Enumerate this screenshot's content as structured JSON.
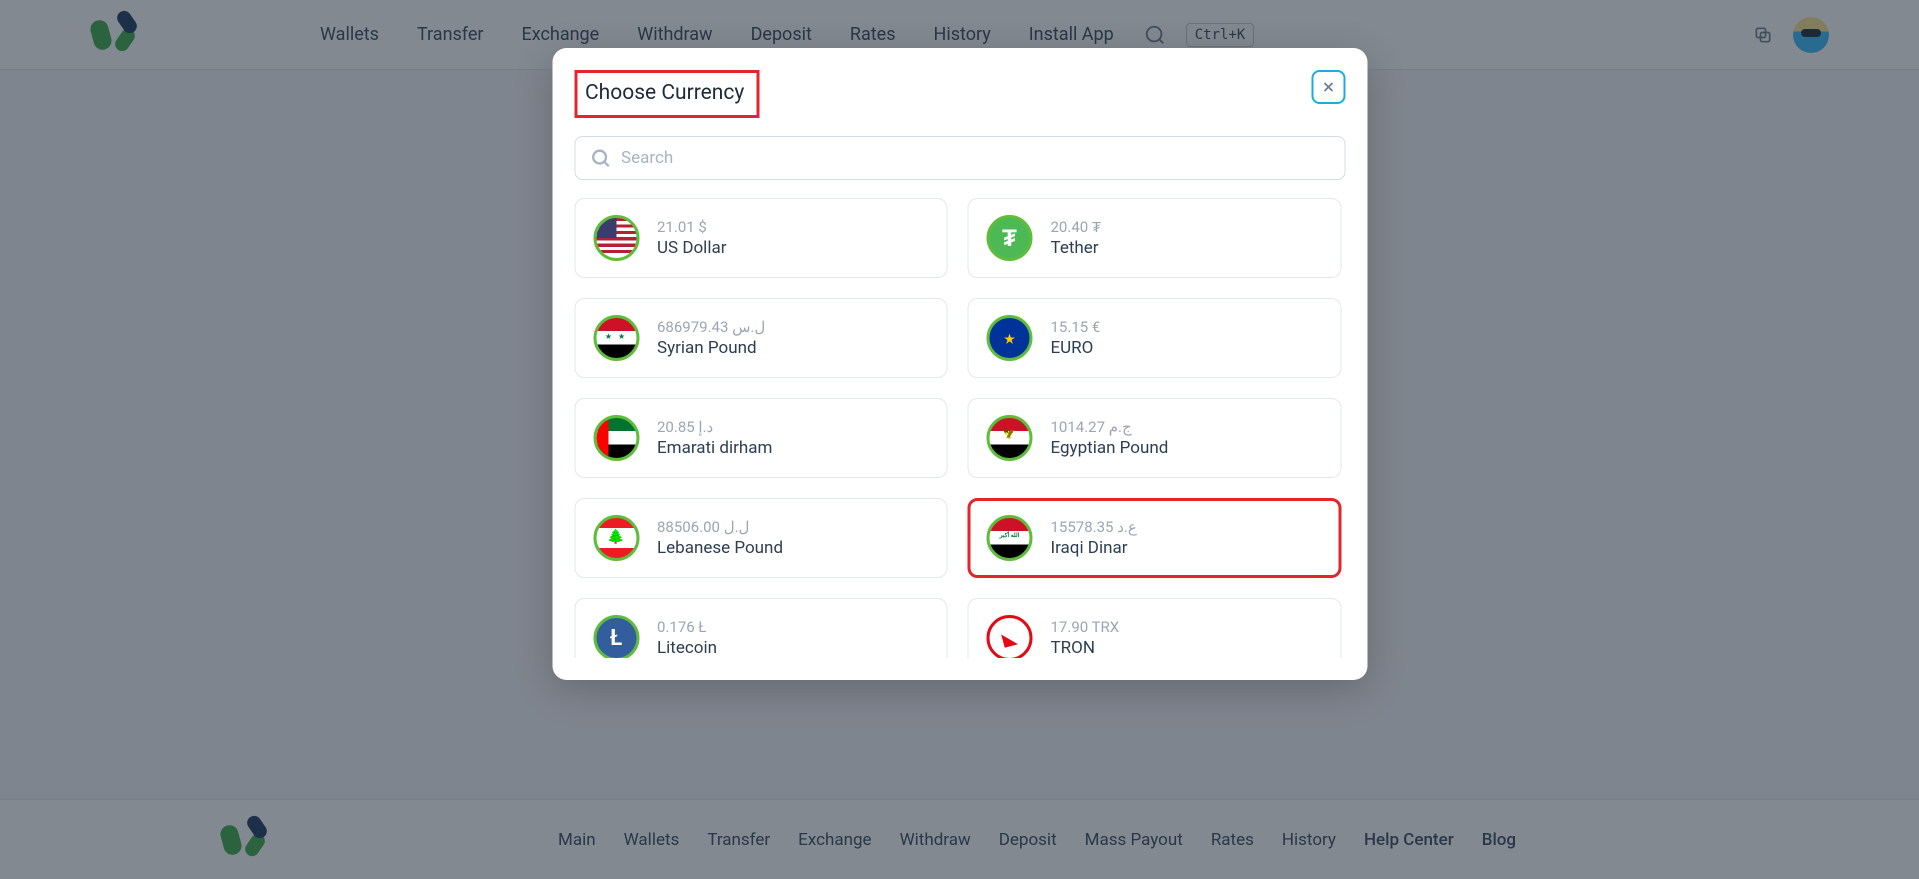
{
  "nav": {
    "items": [
      "Wallets",
      "Transfer",
      "Exchange",
      "Withdraw",
      "Deposit",
      "Rates",
      "History",
      "Install App"
    ],
    "shortcut": "Ctrl+K"
  },
  "modal": {
    "title": "Choose Currency",
    "search_placeholder": "Search",
    "currencies": [
      {
        "amount": "21.01 $",
        "name": "US Dollar",
        "flag": "flag-us",
        "highlighted": false
      },
      {
        "amount": "20.40 ₮",
        "name": "Tether",
        "flag": "flag-tether",
        "highlighted": false
      },
      {
        "amount": "686979.43 ل.س",
        "name": "Syrian Pound",
        "flag": "flag-syria",
        "highlighted": false
      },
      {
        "amount": "15.15 €",
        "name": "EURO",
        "flag": "flag-euro",
        "highlighted": false
      },
      {
        "amount": "20.85 د.إ",
        "name": "Emarati dirham",
        "flag": "flag-uae",
        "highlighted": false
      },
      {
        "amount": "1014.27 ج.م",
        "name": "Egyptian Pound",
        "flag": "flag-egypt",
        "highlighted": false
      },
      {
        "amount": "88506.00 ل.ل",
        "name": "Lebanese Pound",
        "flag": "flag-lebanon",
        "highlighted": false
      },
      {
        "amount": "15578.35 ع.د",
        "name": "Iraqi Dinar",
        "flag": "flag-iraq",
        "highlighted": true
      },
      {
        "amount": "0.176 Ł",
        "name": "Litecoin",
        "flag": "flag-ltc",
        "highlighted": false
      },
      {
        "amount": "17.90 TRX",
        "name": "TRON",
        "flag": "flag-tron",
        "highlighted": false
      }
    ]
  },
  "footer": {
    "items": [
      "Main",
      "Wallets",
      "Transfer",
      "Exchange",
      "Withdraw",
      "Deposit",
      "Mass Payout",
      "Rates",
      "History",
      "Help Center",
      "Blog"
    ]
  }
}
